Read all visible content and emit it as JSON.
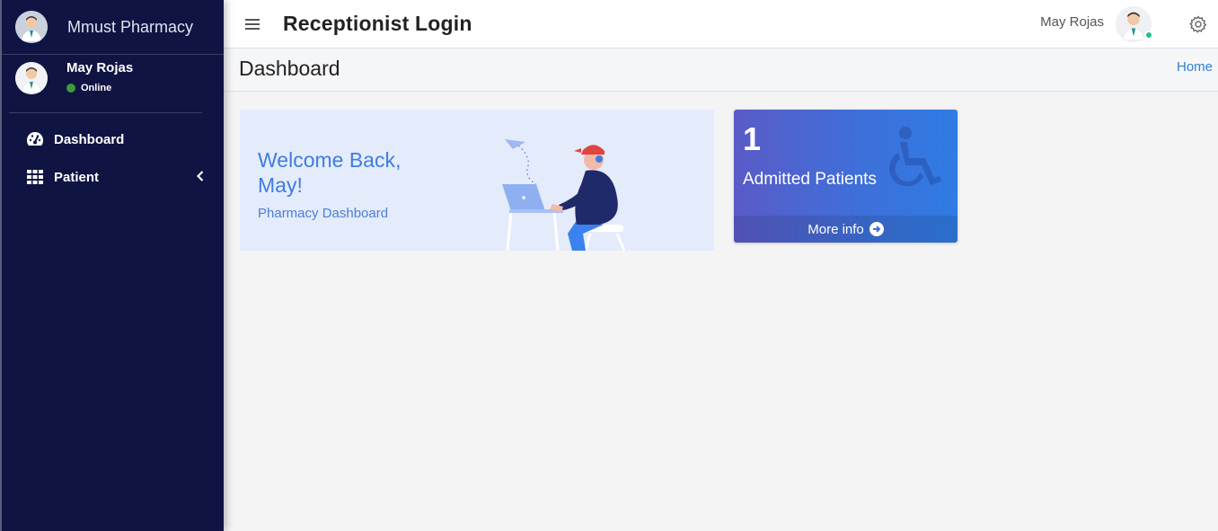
{
  "sidebar": {
    "brand": "Mmust Pharmacy",
    "user": {
      "name": "May Rojas",
      "status": "Online"
    },
    "items": [
      {
        "label": "Dashboard",
        "icon": "tachometer-icon"
      },
      {
        "label": "Patient",
        "icon": "grid-icon"
      }
    ]
  },
  "topbar": {
    "title": "Receptionist Login",
    "user_name": "May Rojas"
  },
  "content_header": {
    "title": "Dashboard",
    "breadcrumb": "Home"
  },
  "welcome": {
    "heading": "Welcome Back, May!",
    "subheading": "Pharmacy Dashboard"
  },
  "stat_box": {
    "count": "1",
    "label": "Admitted Patients",
    "footer": "More info",
    "icon": "wheelchair-icon"
  },
  "colors": {
    "sidebar_bg": "#0f1442",
    "accent": "#3e7de0",
    "online": "#1ec28b"
  }
}
